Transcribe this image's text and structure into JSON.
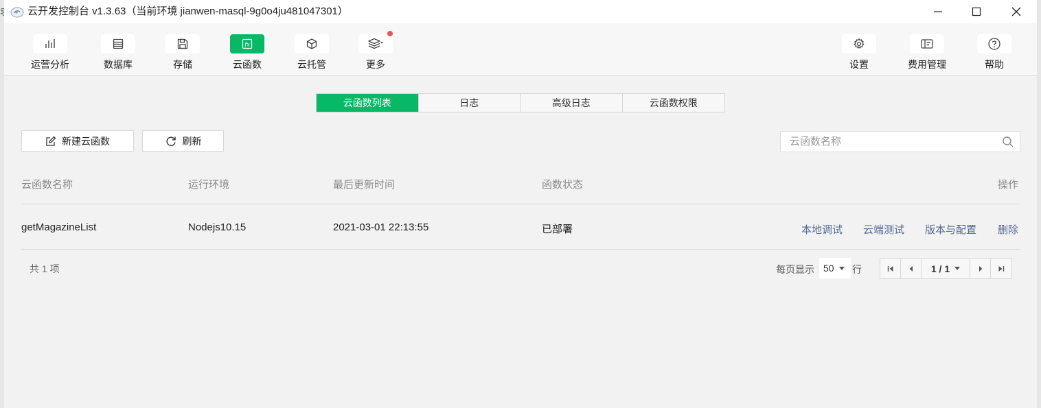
{
  "window": {
    "title": "云开发控制台 v1.3.63（当前环境 jianwen-masql-9g0o4ju481047301）",
    "edge_fragment": "零"
  },
  "toolbar": {
    "left": [
      {
        "label": "运营分析",
        "icon": "bar-chart-icon"
      },
      {
        "label": "数据库",
        "icon": "database-icon"
      },
      {
        "label": "存储",
        "icon": "floppy-disk-icon"
      },
      {
        "label": "云函数",
        "icon": "function-icon",
        "active": true
      },
      {
        "label": "云托管",
        "icon": "cube-icon"
      },
      {
        "label": "更多",
        "icon": "layers-icon"
      }
    ],
    "right": [
      {
        "label": "设置",
        "icon": "gear-icon"
      },
      {
        "label": "费用管理",
        "icon": "billing-icon"
      },
      {
        "label": "帮助",
        "icon": "help-icon"
      }
    ]
  },
  "tabs": [
    {
      "label": "云函数列表",
      "active": true
    },
    {
      "label": "日志"
    },
    {
      "label": "高级日志"
    },
    {
      "label": "云函数权限"
    }
  ],
  "actions": {
    "new_function": "新建云函数",
    "refresh": "刷新"
  },
  "search": {
    "placeholder": "云函数名称"
  },
  "table": {
    "headers": [
      "云函数名称",
      "运行环境",
      "最后更新时间",
      "函数状态",
      "操作"
    ],
    "rows": [
      {
        "name": "getMagazineList",
        "runtime": "Nodejs10.15",
        "updated": "2021-03-01 22:13:55",
        "status": "已部署",
        "ops": [
          "本地调试",
          "云端测试",
          "版本与配置",
          "删除"
        ]
      }
    ]
  },
  "footer": {
    "total": "共 1 项",
    "per_page_label": "每页显示",
    "per_page_value": "50",
    "per_page_suffix": "行",
    "page_status": "1 / 1"
  },
  "colors": {
    "accent": "#07b866",
    "link": "#576b95",
    "badge": "#e9545a"
  }
}
